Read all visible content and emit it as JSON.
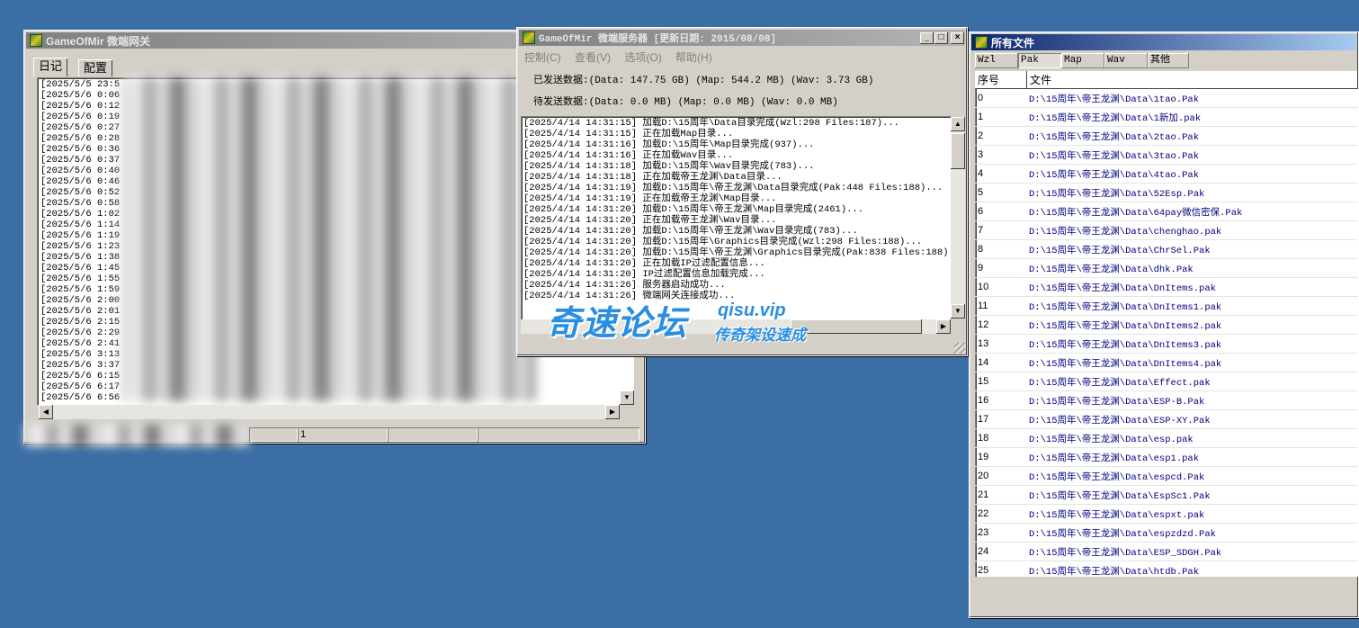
{
  "gateway": {
    "title": "GameOfMir 微端网关",
    "tabs": [
      "日记",
      "配置"
    ],
    "log_lines": [
      "[2025/5/5 23:5",
      "[2025/5/6 0:06",
      "[2025/5/6 0:12",
      "[2025/5/6 0:19",
      "[2025/5/6 0:27",
      "[2025/5/6 0:28",
      "[2025/5/6 0:36",
      "[2025/5/6 0:37",
      "[2025/5/6 0:40",
      "[2025/5/6 0:46",
      "[2025/5/6 0:52",
      "[2025/5/6 0:58",
      "[2025/5/6 1:02",
      "[2025/5/6 1:14",
      "[2025/5/6 1:19",
      "[2025/5/6 1:23",
      "[2025/5/6 1:38",
      "[2025/5/6 1:45",
      "[2025/5/6 1:55",
      "[2025/5/6 1:59",
      "[2025/5/6 2:00",
      "[2025/5/6 2:01",
      "[2025/5/6 2:15",
      "[2025/5/6 2:29",
      "[2025/5/6 2:41",
      "[2025/5/6 3:13",
      "[2025/5/6 3:37",
      "[2025/5/6 6:15",
      "[2025/5/6 6:17",
      "[2025/5/6 6:56"
    ],
    "status_count": "1"
  },
  "server": {
    "title": "GameOfMir 微端服务器 [更新日期: 2015/08/08]",
    "menu": [
      "控制(C)",
      "查看(V)",
      "选项(O)",
      "帮助(H)"
    ],
    "sent_line": "已发送数据:(Data: 147.75 GB) (Map: 544.2 MB) (Wav: 3.73 GB)",
    "pending_line": "待发送数据:(Data: 0.0 MB) (Map: 0.0 MB) (Wav: 0.0 MB)",
    "log": [
      "[2025/4/14 14:31:15] 加载D:\\15周年\\Data目录完成(Wzl:298 Files:187)...",
      "[2025/4/14 14:31:15] 正在加载Map目录...",
      "[2025/4/14 14:31:16] 加载D:\\15周年\\Map目录完成(937)...",
      "[2025/4/14 14:31:16] 正在加载Wav目录...",
      "[2025/4/14 14:31:18] 加载D:\\15周年\\Wav目录完成(783)...",
      "[2025/4/14 14:31:18] 正在加载帝王龙渊\\Data目录...",
      "[2025/4/14 14:31:19] 加载D:\\15周年\\帝王龙渊\\Data目录完成(Pak:448 Files:188)...",
      "[2025/4/14 14:31:19] 正在加载帝王龙渊\\Map目录...",
      "[2025/4/14 14:31:20] 加载D:\\15周年\\帝王龙渊\\Map目录完成(2461)...",
      "[2025/4/14 14:31:20] 正在加载帝王龙渊\\Wav目录...",
      "[2025/4/14 14:31:20] 加载D:\\15周年\\帝王龙渊\\Wav目录完成(783)...",
      "[2025/4/14 14:31:20] 加载D:\\15周年\\Graphics目录完成(Wzl:298 Files:188)...",
      "[2025/4/14 14:31:20] 加载D:\\15周年\\帝王龙渊\\Graphics目录完成(Pak:838 Files:188)",
      "[2025/4/14 14:31:20] 正在加载IP过滤配置信息...",
      "[2025/4/14 14:31:20] IP过滤配置信息加载完成...",
      "[2025/4/14 14:31:26] 服务器启动成功...",
      "[2025/4/14 14:31:26] 微端网关连接成功..."
    ]
  },
  "watermark": {
    "main": "奇速论坛",
    "site": "qisu.vip",
    "slogan": "传奇架设速成"
  },
  "files": {
    "title": "所有文件",
    "tabs": [
      "Wzl",
      "Pak",
      "Map",
      "Wav",
      "其他"
    ],
    "selected_tab": "Pak",
    "col_index": "序号",
    "col_file": "文件",
    "rows": [
      {
        "i": "0",
        "f": "D:\\15周年\\帝王龙渊\\Data\\1tao.Pak"
      },
      {
        "i": "1",
        "f": "D:\\15周年\\帝王龙渊\\Data\\1新加.pak"
      },
      {
        "i": "2",
        "f": "D:\\15周年\\帝王龙渊\\Data\\2tao.Pak"
      },
      {
        "i": "3",
        "f": "D:\\15周年\\帝王龙渊\\Data\\3tao.Pak"
      },
      {
        "i": "4",
        "f": "D:\\15周年\\帝王龙渊\\Data\\4tao.Pak"
      },
      {
        "i": "5",
        "f": "D:\\15周年\\帝王龙渊\\Data\\52Esp.Pak"
      },
      {
        "i": "6",
        "f": "D:\\15周年\\帝王龙渊\\Data\\64pay微信密保.Pak"
      },
      {
        "i": "7",
        "f": "D:\\15周年\\帝王龙渊\\Data\\chenghao.pak"
      },
      {
        "i": "8",
        "f": "D:\\15周年\\帝王龙渊\\Data\\ChrSel.Pak"
      },
      {
        "i": "9",
        "f": "D:\\15周年\\帝王龙渊\\Data\\dhk.Pak"
      },
      {
        "i": "10",
        "f": "D:\\15周年\\帝王龙渊\\Data\\DnItems.pak"
      },
      {
        "i": "11",
        "f": "D:\\15周年\\帝王龙渊\\Data\\DnItems1.pak"
      },
      {
        "i": "12",
        "f": "D:\\15周年\\帝王龙渊\\Data\\DnItems2.pak"
      },
      {
        "i": "13",
        "f": "D:\\15周年\\帝王龙渊\\Data\\DnItems3.pak"
      },
      {
        "i": "14",
        "f": "D:\\15周年\\帝王龙渊\\Data\\DnItems4.pak"
      },
      {
        "i": "15",
        "f": "D:\\15周年\\帝王龙渊\\Data\\Effect.pak"
      },
      {
        "i": "16",
        "f": "D:\\15周年\\帝王龙渊\\Data\\ESP-B.Pak"
      },
      {
        "i": "17",
        "f": "D:\\15周年\\帝王龙渊\\Data\\ESP-XY.Pak"
      },
      {
        "i": "18",
        "f": "D:\\15周年\\帝王龙渊\\Data\\esp.pak"
      },
      {
        "i": "19",
        "f": "D:\\15周年\\帝王龙渊\\Data\\esp1.pak"
      },
      {
        "i": "20",
        "f": "D:\\15周年\\帝王龙渊\\Data\\espcd.Pak"
      },
      {
        "i": "21",
        "f": "D:\\15周年\\帝王龙渊\\Data\\EspSc1.Pak"
      },
      {
        "i": "22",
        "f": "D:\\15周年\\帝王龙渊\\Data\\espxt.pak"
      },
      {
        "i": "23",
        "f": "D:\\15周年\\帝王龙渊\\Data\\espzdzd.Pak"
      },
      {
        "i": "24",
        "f": "D:\\15周年\\帝王龙渊\\Data\\ESP_SDGH.Pak"
      },
      {
        "i": "25",
        "f": "D:\\15周年\\帝王龙渊\\Data\\htdb.Pak"
      }
    ]
  },
  "colors": {
    "desktop": "#3a6ea5",
    "active_title": "#0a246a",
    "file_text": "#000080"
  }
}
